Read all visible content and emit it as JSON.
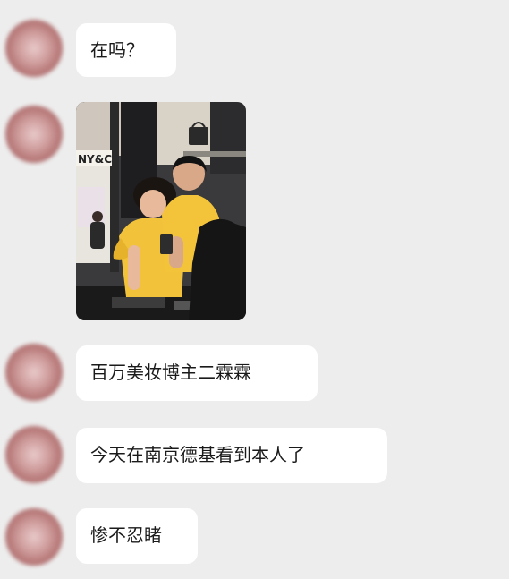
{
  "messages": [
    {
      "type": "text",
      "text": "在吗？"
    },
    {
      "type": "image",
      "image_alt": ""
    },
    {
      "type": "text",
      "text": "百万美妆博主二霖霖"
    },
    {
      "type": "text",
      "text": "今天在南京德基看到本人了"
    },
    {
      "type": "text",
      "text": "惨不忍睹"
    }
  ],
  "photo": {
    "sign_text": "NY&C"
  },
  "colors": {
    "background": "#ededed",
    "bubble": "#ffffff",
    "text": "#1a1a1a",
    "shirt_yellow": "#f2c23a"
  }
}
